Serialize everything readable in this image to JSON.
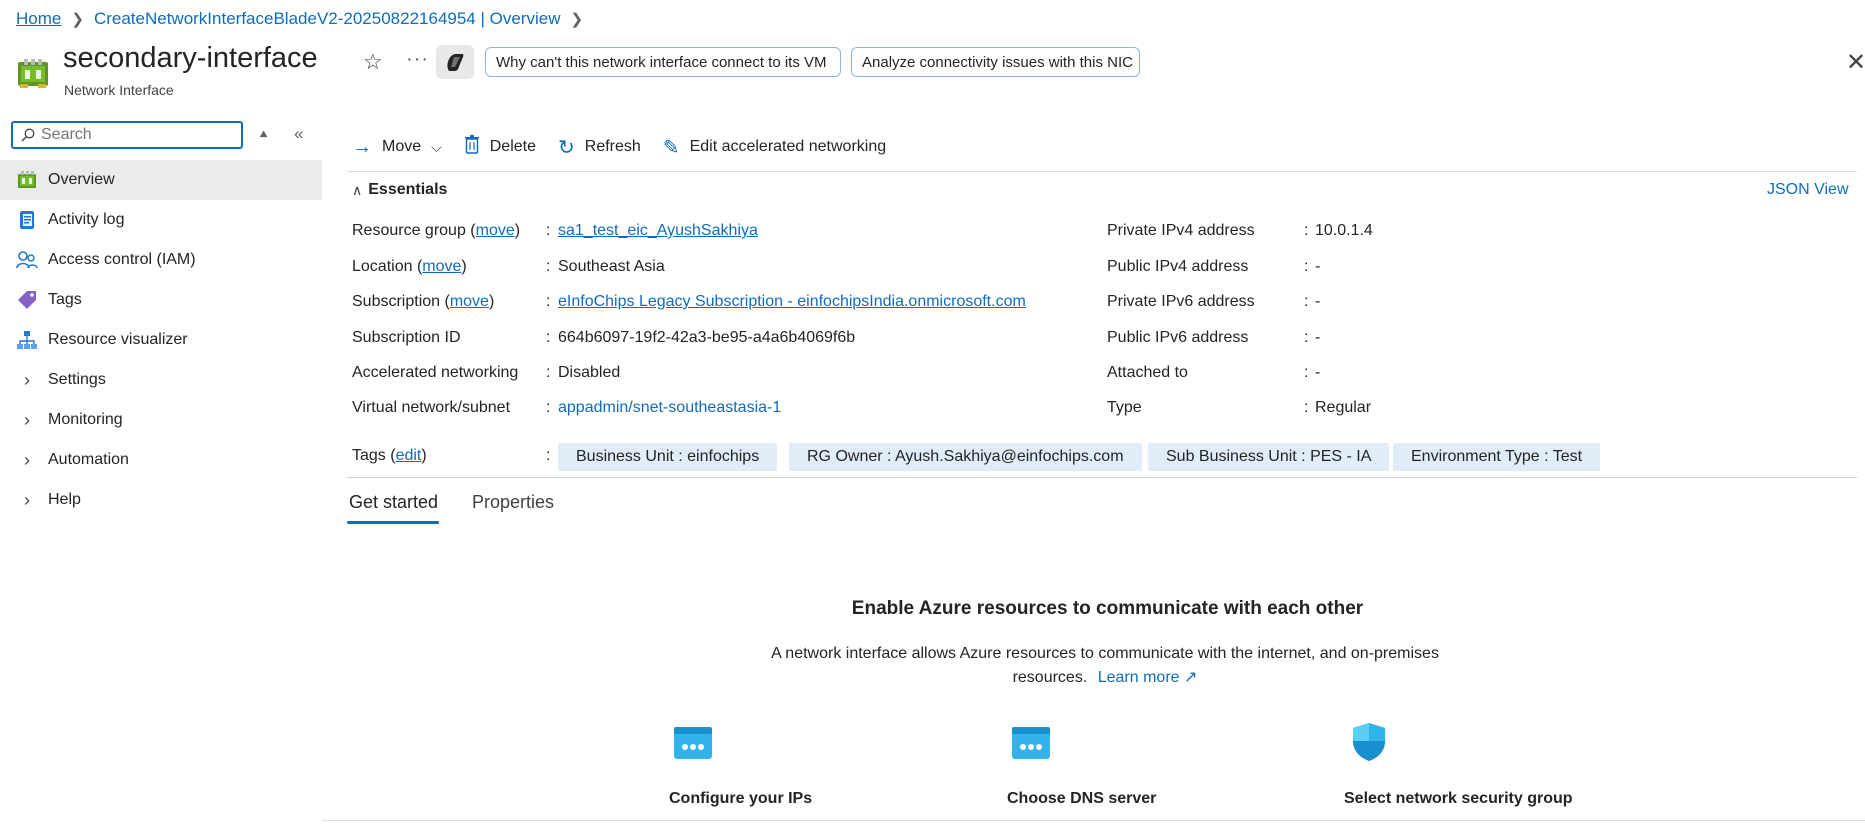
{
  "breadcrumb": {
    "home": "Home",
    "blade": "CreateNetworkInterfaceBladeV2-20250822164954 | Overview"
  },
  "resource": {
    "name": "secondary-interface",
    "type": "Network Interface"
  },
  "copilot_prompts": [
    "Why can't this network interface connect to its VM",
    "Analyze connectivity issues with this NIC"
  ],
  "search": {
    "placeholder": "Search",
    "value": ""
  },
  "sidebar": {
    "items": [
      {
        "label": "Overview",
        "icon": "network-interface-icon",
        "active": true
      },
      {
        "label": "Activity log",
        "icon": "activity-log-icon"
      },
      {
        "label": "Access control (IAM)",
        "icon": "people-icon"
      },
      {
        "label": "Tags",
        "icon": "tag-icon"
      },
      {
        "label": "Resource visualizer",
        "icon": "hierarchy-icon"
      },
      {
        "label": "Settings",
        "icon": "chevron-right-icon"
      },
      {
        "label": "Monitoring",
        "icon": "chevron-right-icon"
      },
      {
        "label": "Automation",
        "icon": "chevron-right-icon"
      },
      {
        "label": "Help",
        "icon": "chevron-right-icon"
      }
    ]
  },
  "toolbar": {
    "move": "Move",
    "delete": "Delete",
    "refresh": "Refresh",
    "edit_accel": "Edit accelerated networking"
  },
  "essentials": {
    "heading": "Essentials",
    "json_view": "JSON View",
    "move_link": "move",
    "edit_link": "edit",
    "left": [
      {
        "label": "Resource group",
        "value": "sa1_test_eic_AyushSakhiya"
      },
      {
        "label": "Location",
        "value": "Southeast Asia"
      },
      {
        "label": "Subscription",
        "value": "eInfoChips Legacy Subscription - einfochipsIndia.onmicrosoft.com"
      },
      {
        "label": "Subscription ID",
        "value": "664b6097-19f2-42a3-be95-a4a6b4069f6b"
      },
      {
        "label": "Accelerated networking",
        "value": "Disabled"
      },
      {
        "label": "Virtual network/subnet",
        "value": "appadmin/snet-southeastasia-1"
      }
    ],
    "right": [
      {
        "label": "Private IPv4 address",
        "value": "10.0.1.4"
      },
      {
        "label": "Public IPv4 address",
        "value": "-"
      },
      {
        "label": "Private IPv6 address",
        "value": "-"
      },
      {
        "label": "Public IPv6 address",
        "value": "-"
      },
      {
        "label": "Attached to",
        "value": "-"
      },
      {
        "label": "Type",
        "value": "Regular"
      }
    ],
    "tags_label": "Tags",
    "tags": [
      "Business Unit : einfochips",
      "RG Owner : Ayush.Sakhiya@einfochips.com",
      "Sub Business Unit : PES - IA",
      "Environment Type : Test"
    ]
  },
  "tabs": [
    "Get started",
    "Properties"
  ],
  "get_started": {
    "title": "Enable Azure resources to communicate with each other",
    "description": "A network interface allows Azure resources to communicate with the internet, and on-premises resources.",
    "learn_more": "Learn more",
    "cards": [
      {
        "title": "Configure your IPs",
        "icon": "ip-address-icon"
      },
      {
        "title": "Choose DNS server",
        "icon": "dns-server-icon"
      },
      {
        "title": "Select network security group",
        "icon": "shield-icon"
      }
    ]
  }
}
